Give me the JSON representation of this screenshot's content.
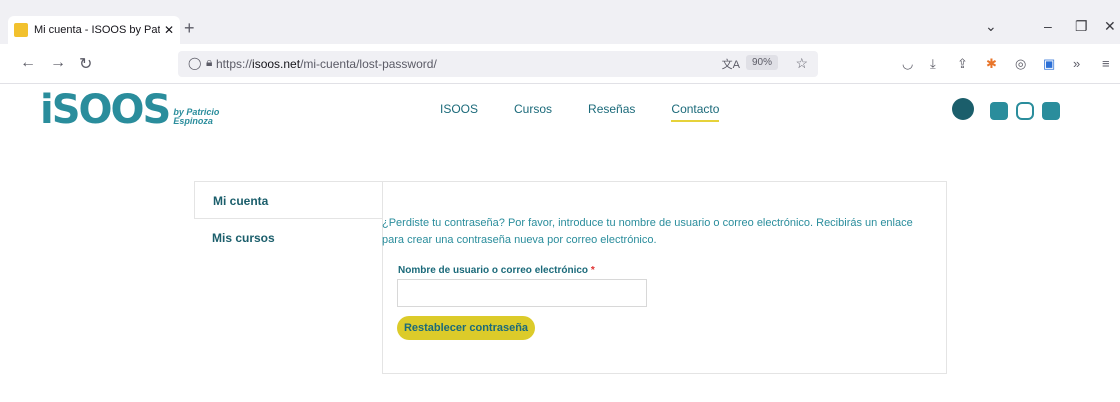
{
  "browser": {
    "tab_title": "Mi cuenta - ISOOS by Patricio E",
    "url_prefix": "https://",
    "url_domain": "isoos.net",
    "url_path": "/mi-cuenta/lost-password/",
    "zoom": "90%"
  },
  "site": {
    "logo_text": "iSOOS",
    "logo_by": "by",
    "logo_name1": "Patricio",
    "logo_name2": "Espinoza",
    "menu": [
      "ISOOS",
      "Cursos",
      "Reseñas",
      "Contacto"
    ],
    "active_menu": "Contacto",
    "social": [
      {
        "name": "youtube-icon",
        "color": "#2a8d9c"
      },
      {
        "name": "instagram-icon",
        "color": "#2a8d9c"
      },
      {
        "name": "linkedin-icon",
        "color": "#2a8d9c"
      }
    ]
  },
  "account": {
    "nav": [
      "Mi cuenta",
      "Mis cursos"
    ],
    "intro": "¿Perdiste tu contraseña? Por favor, introduce tu nombre de usuario o correo electrónico. Recibirás un enlace para crear una contraseña nueva por correo electrónico.",
    "field_label": "Nombre de usuario o correo electrónico",
    "required_mark": "*",
    "field_value": "",
    "reset_label": "Restablecer contraseña"
  }
}
